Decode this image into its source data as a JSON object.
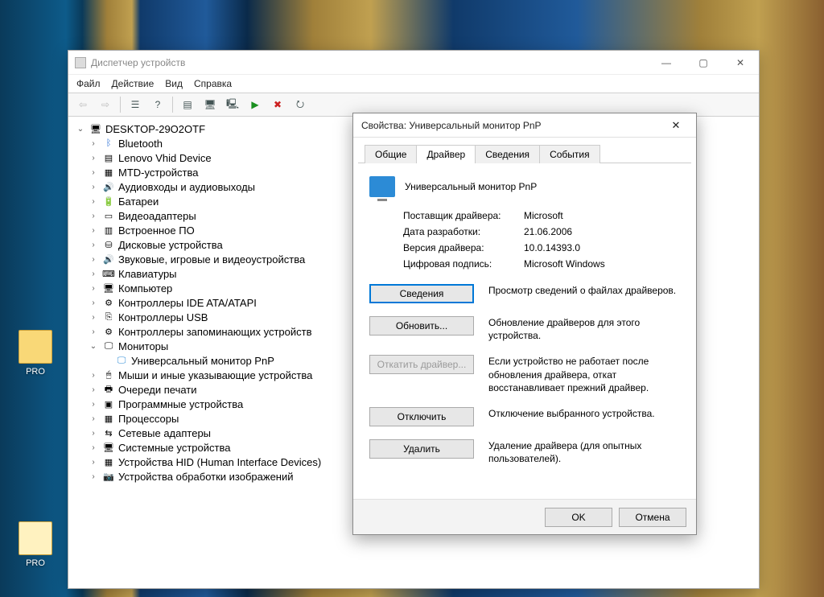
{
  "desktop": {
    "icon1_label": "PRO",
    "icon2_label": "PRO"
  },
  "window": {
    "title": "Диспетчер устройств",
    "menu": {
      "file": "Файл",
      "action": "Действие",
      "view": "Вид",
      "help": "Справка"
    },
    "tree": {
      "root": "DESKTOP-29O2OTF",
      "items": [
        "Bluetooth",
        "Lenovo Vhid Device",
        "MTD-устройства",
        "Аудиовходы и аудиовыходы",
        "Батареи",
        "Видеоадаптеры",
        "Встроенное ПО",
        "Дисковые устройства",
        "Звуковые, игровые и видеоустройства",
        "Клавиатуры",
        "Компьютер",
        "Контроллеры IDE ATA/ATAPI",
        "Контроллеры USB",
        "Контроллеры запоминающих устройств",
        "Мониторы",
        "Мыши и иные указывающие устройства",
        "Очереди печати",
        "Программные устройства",
        "Процессоры",
        "Сетевые адаптеры",
        "Системные устройства",
        "Устройства HID (Human Interface Devices)",
        "Устройства обработки изображений"
      ],
      "monitor_child": "Универсальный монитор PnP"
    }
  },
  "dialog": {
    "title": "Свойства: Универсальный монитор PnP",
    "tabs": {
      "general": "Общие",
      "driver": "Драйвер",
      "details": "Сведения",
      "events": "События"
    },
    "heading": "Универсальный монитор PnP",
    "props": {
      "provider_l": "Поставщик драйвера:",
      "provider_v": "Microsoft",
      "date_l": "Дата разработки:",
      "date_v": "21.06.2006",
      "version_l": "Версия драйвера:",
      "version_v": "10.0.14393.0",
      "signer_l": "Цифровая подпись:",
      "signer_v": "Microsoft Windows"
    },
    "buttons": {
      "details": {
        "label": "Сведения",
        "desc": "Просмотр сведений о файлах драйверов."
      },
      "update": {
        "label": "Обновить...",
        "desc": "Обновление драйверов для этого устройства."
      },
      "rollback": {
        "label": "Откатить драйвер...",
        "desc": "Если устройство не работает после обновления драйвера, откат восстанавливает прежний драйвер."
      },
      "disable": {
        "label": "Отключить",
        "desc": "Отключение выбранного устройства."
      },
      "delete": {
        "label": "Удалить",
        "desc": "Удаление драйвера (для опытных пользователей)."
      }
    },
    "ok": "OK",
    "cancel": "Отмена"
  }
}
